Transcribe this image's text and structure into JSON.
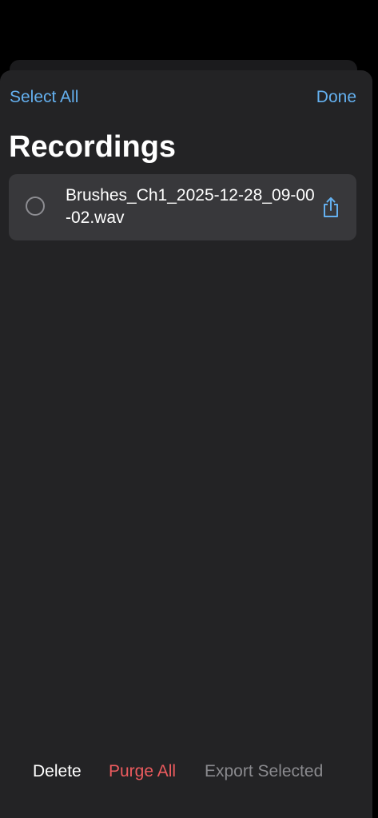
{
  "header": {
    "select_all_label": "Select All",
    "done_label": "Done",
    "title": "Recordings"
  },
  "recordings": [
    {
      "filename": "Brushes_Ch1_2025-12-28_09-00-02.wav",
      "selected": false,
      "icon": "share-icon"
    }
  ],
  "footer": {
    "delete_label": "Delete",
    "purge_all_label": "Purge All",
    "export_selected_label": "Export Selected"
  },
  "colors": {
    "accent": "#64b0ef",
    "destructive": "#ec5b5e",
    "disabled": "#8a8a8e",
    "sheet_background": "#232325",
    "row_background": "#38383b"
  }
}
